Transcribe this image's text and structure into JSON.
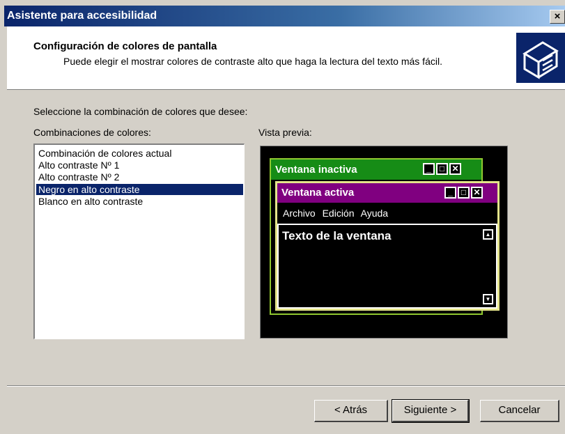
{
  "window": {
    "title": "Asistente para accesibilidad",
    "close_glyph": "×"
  },
  "header": {
    "title": "Configuración de colores de pantalla",
    "subtitle": "Puede elegir el mostrar colores de contraste alto que haga la lectura del texto más fácil.",
    "icon": "accessibility-wizard-icon"
  },
  "main": {
    "prompt": "Seleccione la combinación de colores que desee:",
    "list_label": "Combinaciones de colores:",
    "preview_label": "Vista previa:",
    "schemes": [
      {
        "label": "Combinación de colores actual",
        "selected": false
      },
      {
        "label": "Alto contraste Nº 1",
        "selected": false
      },
      {
        "label": "Alto contraste Nº 2",
        "selected": false
      },
      {
        "label": "Negro en alto contraste",
        "selected": true
      },
      {
        "label": "Blanco en alto contraste",
        "selected": false
      }
    ]
  },
  "preview": {
    "inactive_title": "Ventana inactiva",
    "active_title": "Ventana activa",
    "menu": [
      "Archivo",
      "Edición",
      "Ayuda"
    ],
    "window_text": "Texto de la ventana",
    "colors": {
      "inactive_bar": "#168c16",
      "active_bar": "#800080",
      "background": "#000000"
    }
  },
  "buttons": {
    "back": "< Atrás",
    "next": "Siguiente >",
    "cancel": "Cancelar"
  }
}
